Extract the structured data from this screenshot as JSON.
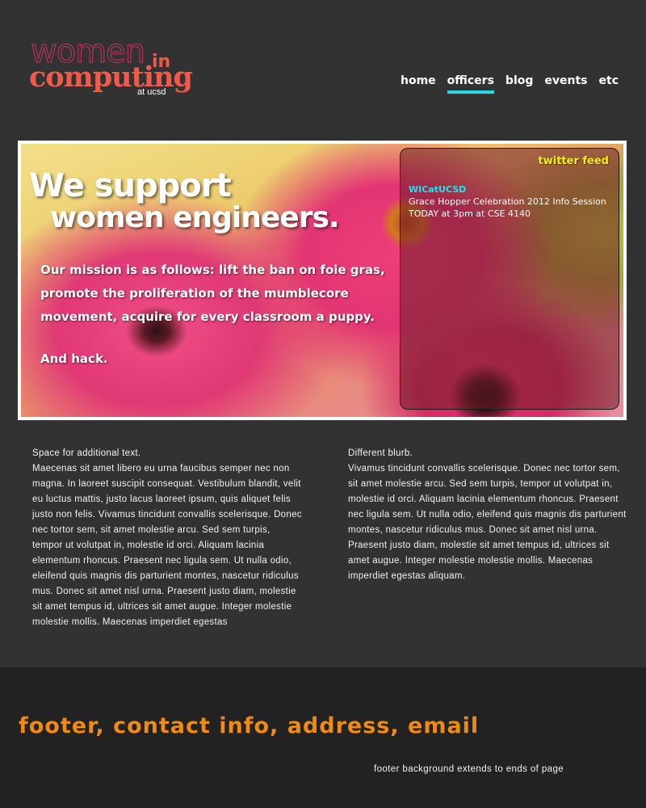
{
  "logo": {
    "line1": "women",
    "line2": "in",
    "line3": "computing",
    "line4": "at ucsd"
  },
  "nav": {
    "items": [
      {
        "label": "home",
        "active": false
      },
      {
        "label": "officers",
        "active": true
      },
      {
        "label": "blog",
        "active": false
      },
      {
        "label": "events",
        "active": false
      },
      {
        "label": "etc",
        "active": false
      }
    ],
    "active_color": "#27d9e6"
  },
  "banner": {
    "title_line1": "We support",
    "title_line2": "women engineers.",
    "mission": "Our mission is as follows: lift the ban on foie gras, promote the proliferation of the mumblecore movement, acquire for every classroom a puppy.",
    "closing": "And hack."
  },
  "twitter": {
    "label": "twitter feed",
    "user": "WICatUCSD",
    "text": "Grace Hopper Celebration 2012 Info Session TODAY at 3pm at CSE 4140"
  },
  "content": {
    "left": {
      "heading": "Space for additional text.",
      "body": "Maecenas sit amet libero eu urna faucibus semper nec non magna. In laoreet suscipit consequat. Vestibulum blandit, velit eu luctus mattis, justo lacus laoreet ipsum, quis aliquet felis justo non felis. Vivamus tincidunt convallis scelerisque. Donec nec tortor sem, sit amet molestie arcu. Sed sem turpis, tempor ut volutpat in, molestie id orci. Aliquam lacinia elementum rhoncus. Praesent nec ligula sem. Ut nulla odio, eleifend quis magnis dis parturient montes, nascetur ridiculus mus. Donec sit amet nisl urna. Praesent justo diam, molestie sit amet tempus id, ultrices sit amet augue. Integer molestie molestie mollis. Maecenas imperdiet egestas"
    },
    "right": {
      "heading": "Different blurb.",
      "body": "Vivamus tincidunt convallis scelerisque. Donec nec tortor sem, sit amet molestie arcu. Sed sem turpis, tempor ut volutpat in, molestie id orci. Aliquam lacinia elementum rhoncus. Praesent nec ligula sem. Ut nulla odio, eleifend quis magnis dis parturient montes, nascetur ridiculus mus. Donec sit amet nisl urna. Praesent justo diam, molestie sit amet tempus id, ultrices sit amet augue. Integer molestie molestie mollis. Maecenas imperdiet egestas aliquam."
    }
  },
  "footer": {
    "title": "footer, contact info, address, email",
    "note": "footer background extends to ends of page"
  },
  "colors": {
    "page_bg": "#323232",
    "footer_bg": "#222222",
    "footer_title": "#f08a12",
    "logo": "#f05a4a",
    "logo_outline": "#cc2f68",
    "twitter_label": "#f5f011",
    "twitter_user": "#23e3ee"
  }
}
